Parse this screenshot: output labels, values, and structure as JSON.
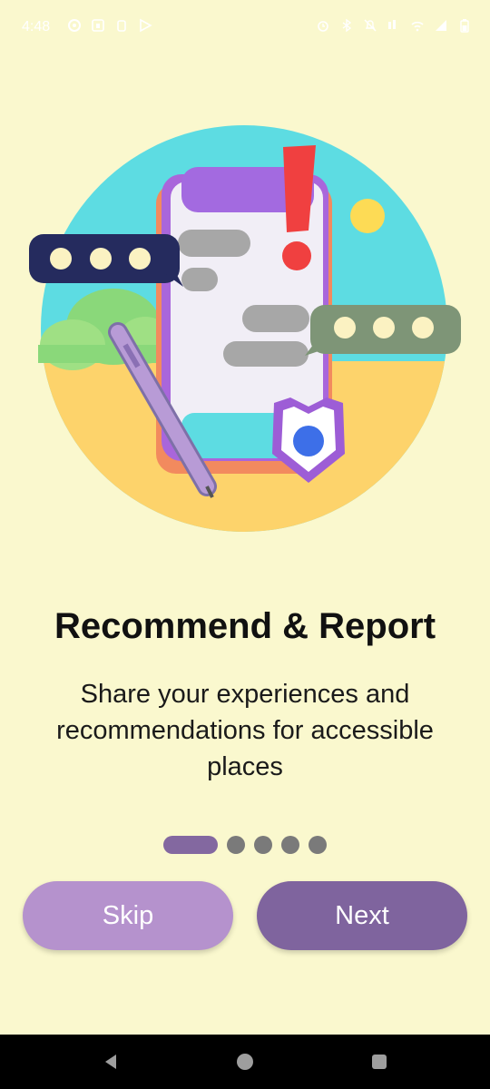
{
  "status_bar": {
    "time": "4:48",
    "left_icons": [
      "settings-icon",
      "calendar-icon",
      "lock-icon",
      "play-store-icon"
    ],
    "right_icons": [
      "alarm-icon",
      "bluetooth-icon",
      "mute-icon",
      "data-icon",
      "wifi-icon",
      "signal-icon",
      "battery-icon"
    ]
  },
  "onboarding": {
    "title": "Recommend & Report",
    "description": "Share your experiences and recommendations for accessible places",
    "page_indicator": {
      "total": 5,
      "current": 1
    }
  },
  "buttons": {
    "skip": "Skip",
    "next": "Next"
  },
  "nav_bar": {
    "buttons": [
      "back-icon",
      "home-icon",
      "recents-icon"
    ]
  },
  "colors": {
    "background": "#FAF8CE",
    "skip_button": "#B592CD",
    "next_button": "#7F649E",
    "active_dot": "#8368A0",
    "inactive_dot": "#7A7A7A"
  }
}
